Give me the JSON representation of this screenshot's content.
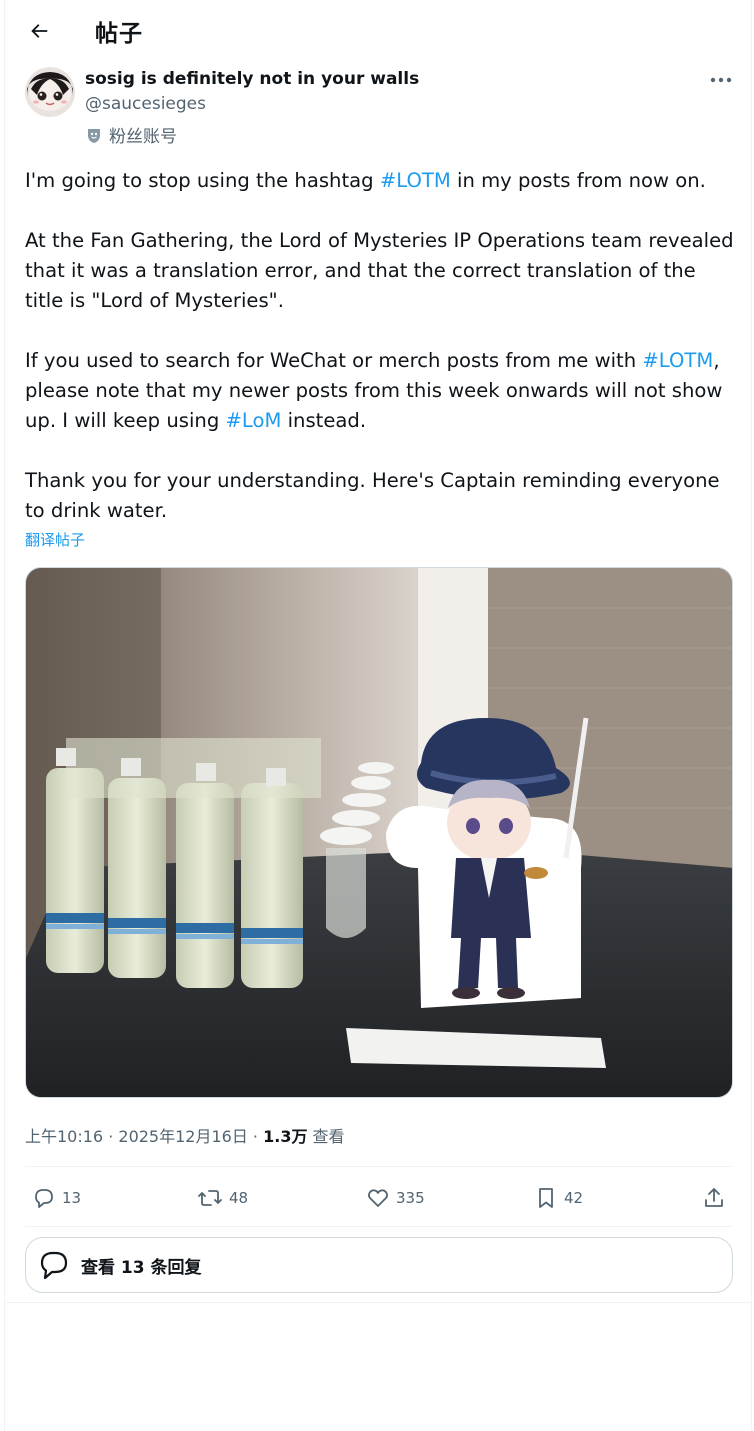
{
  "header": {
    "title": "帖子"
  },
  "author": {
    "display_name": "sosig is definitely not in your walls",
    "handle": "@saucesieges",
    "badge_label": "粉丝账号"
  },
  "tweet": {
    "p1_before": "I'm going to stop using the hashtag ",
    "p1_tag": "#LOTM",
    "p1_after": " in my posts from now on.",
    "p2": "At the Fan Gathering, the Lord of Mysteries IP Operations team revealed that it was a translation error, and that the correct translation of the title is \"Lord of Mysteries\".",
    "p3_before": "If you used to search for WeChat or merch posts from me with ",
    "p3_tag1": "#LOTM",
    "p3_middle": ", please note that my newer posts from this week onwards will not show up. I will keep using ",
    "p3_tag2": "#LoM",
    "p3_after": " instead.",
    "p4": "Thank you for your understanding. Here's Captain reminding everyone to drink water.",
    "translate_label": "翻译帖子"
  },
  "meta": {
    "time": "上午10:16",
    "separator": " · ",
    "date": "2025年12月16日",
    "views_count": "1.3万",
    "views_label": " 查看"
  },
  "actions": {
    "replies": "13",
    "reposts": "48",
    "likes": "335",
    "bookmarks": "42"
  },
  "view_replies_label": "查看 13 条回复",
  "icons": [
    "back-arrow-icon",
    "more-icon",
    "fan-badge-icon",
    "reply-icon",
    "repost-icon",
    "like-icon",
    "bookmark-icon",
    "share-icon",
    "chat-bubble-icon"
  ],
  "colors": {
    "accent": "#1d9bf0",
    "text": "#0f1419",
    "secondary": "#536471",
    "border": "#cfd9de"
  }
}
